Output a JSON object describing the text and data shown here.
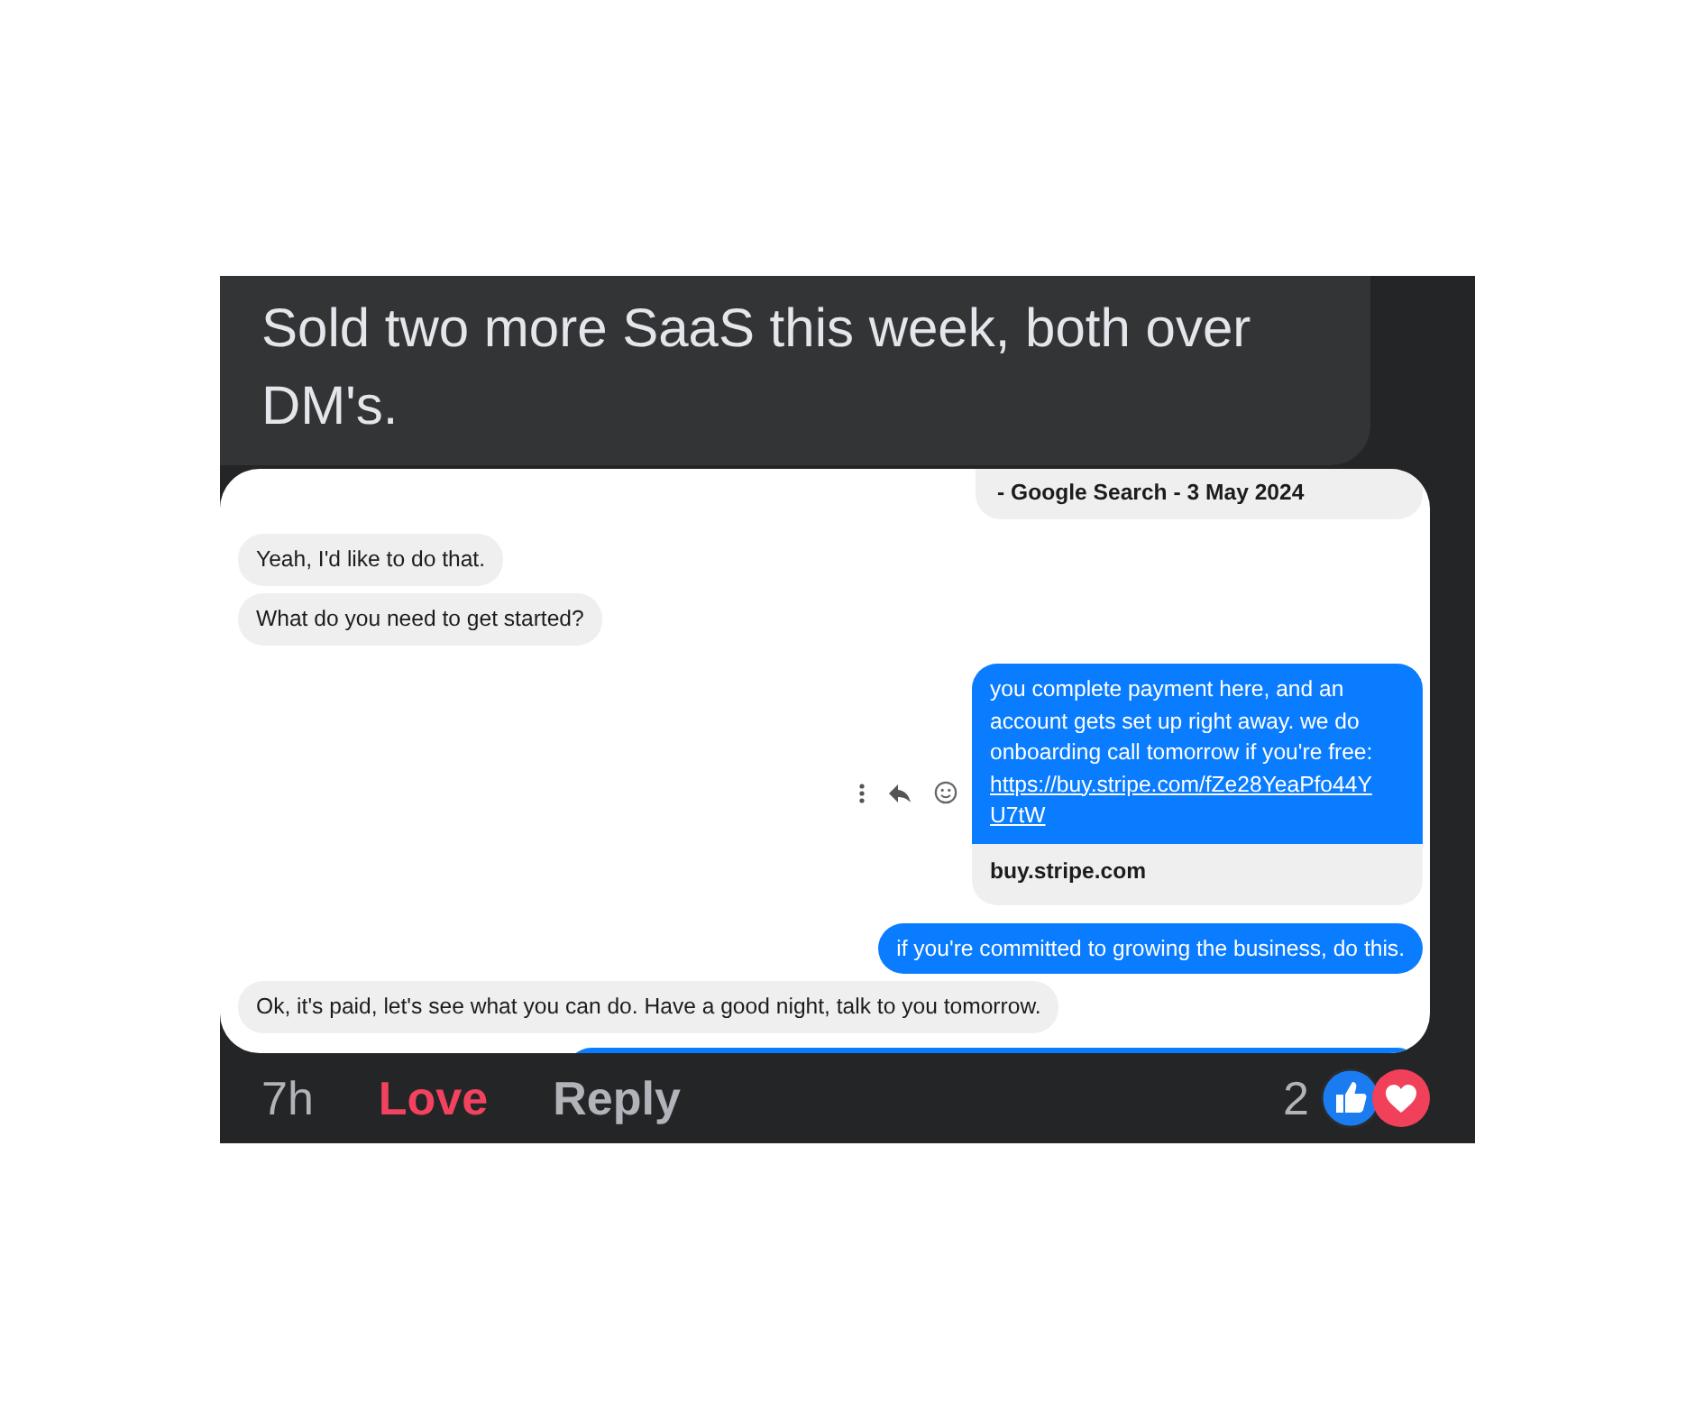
{
  "comment": {
    "text": "Sold two more SaaS this week, both over DM's."
  },
  "messages": [
    {
      "kind": "preview",
      "text": "- Google Search - 3 May 2024"
    },
    {
      "kind": "received",
      "text": "Yeah, I'd like to do that."
    },
    {
      "kind": "received",
      "text": "What do you need to get started?"
    },
    {
      "kind": "sent_link",
      "text": "you complete payment here, and an account gets set up right away. we do onboarding call tomorrow if you're free:",
      "link": "https://buy.stripe.com/fZe28YeaPfo44Y U7tW",
      "preview": "buy.stripe.com"
    },
    {
      "kind": "sent",
      "text": "if you're committed to growing the business, do this."
    },
    {
      "kind": "received",
      "text": "Ok, it's paid, let's see what you can do. Have a good night, talk to you tomorrow."
    },
    {
      "kind": "partial"
    }
  ],
  "footer": {
    "time": "7h",
    "actions": [
      {
        "label": "Love",
        "selected": true
      },
      {
        "label": "Reply",
        "selected": false
      }
    ],
    "reaction_count": "2"
  }
}
